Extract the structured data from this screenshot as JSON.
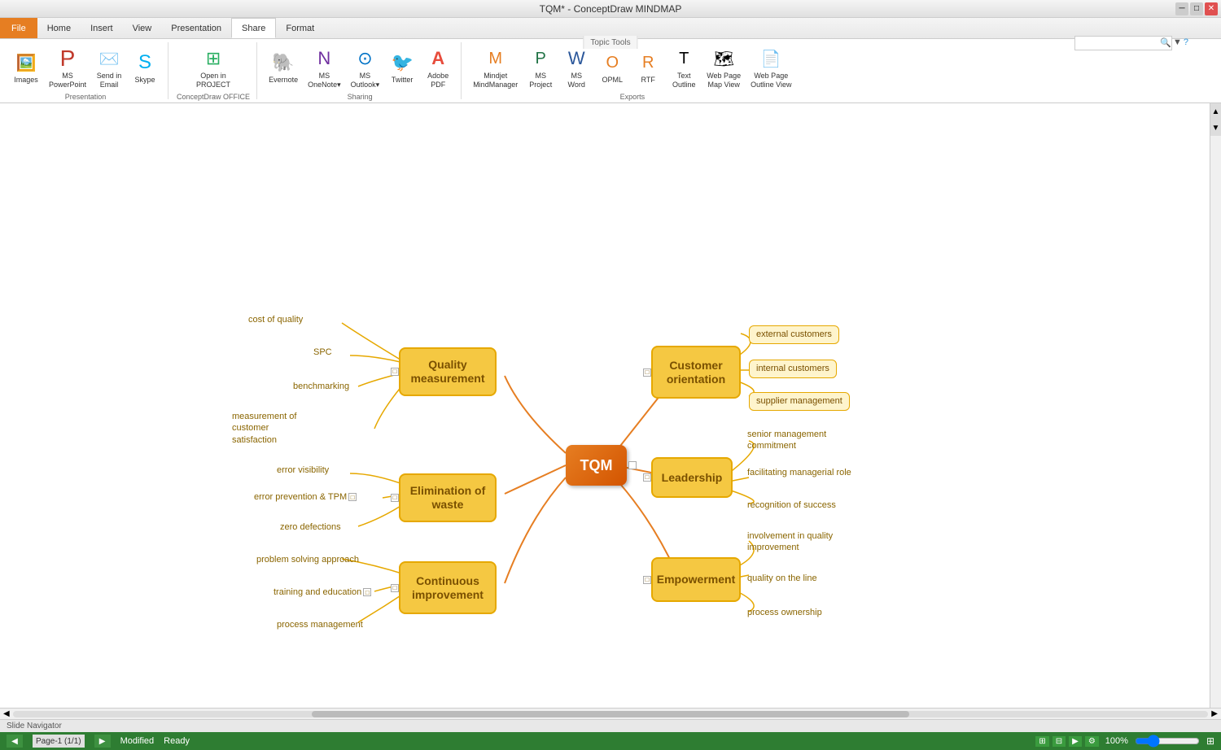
{
  "titleBar": {
    "title": "TQM* - ConceptDraw MINDMAP"
  },
  "ribbon": {
    "topicTools": "Topic Tools",
    "tabs": [
      {
        "label": "File",
        "type": "file",
        "active": false
      },
      {
        "label": "Home",
        "active": false
      },
      {
        "label": "Insert",
        "active": false
      },
      {
        "label": "View",
        "active": false
      },
      {
        "label": "Presentation",
        "active": false
      },
      {
        "label": "Share",
        "active": true
      },
      {
        "label": "Format",
        "active": false
      }
    ],
    "groups": [
      {
        "label": "Presentation",
        "items": [
          {
            "icon": "🖼️",
            "label": "Images",
            "iconClass": ""
          },
          {
            "icon": "📊",
            "label": "MS\nPowerPoint",
            "iconClass": "icon-red"
          },
          {
            "icon": "✉️",
            "label": "Send in\nEmail",
            "iconClass": ""
          },
          {
            "icon": "☁️",
            "label": "Skype",
            "iconClass": "icon-blue"
          }
        ]
      },
      {
        "label": "ConceptDraw OFFICE",
        "items": [
          {
            "icon": "⊞",
            "label": "Open in\nPROJECT",
            "iconClass": "icon-green"
          }
        ]
      },
      {
        "label": "Sharing",
        "items": [
          {
            "icon": "E",
            "label": "Evernote",
            "iconClass": "icon-green",
            "special": "evernote"
          },
          {
            "icon": "N",
            "label": "MS\nOneNote▾",
            "iconClass": "icon-purple",
            "special": "onenote"
          },
          {
            "icon": "⊙",
            "label": "MS\nOutlook▾",
            "iconClass": "icon-blue"
          },
          {
            "icon": "🐦",
            "label": "Twitter",
            "iconClass": "icon-blue",
            "special": "twitter"
          },
          {
            "icon": "A",
            "label": "Adobe\nPDF",
            "iconClass": "icon-red",
            "special": "adobe"
          }
        ]
      },
      {
        "label": "Exports",
        "items": [
          {
            "icon": "M",
            "label": "Mindjet\nMindManager",
            "iconClass": "icon-orange"
          },
          {
            "icon": "📋",
            "label": "MS\nProject",
            "iconClass": "icon-teal"
          },
          {
            "icon": "W",
            "label": "MS\nWord",
            "iconClass": "icon-blue"
          },
          {
            "icon": "O",
            "label": "OPML",
            "iconClass": "icon-orange"
          },
          {
            "icon": "R",
            "label": "RTF",
            "iconClass": "icon-orange"
          },
          {
            "icon": "T",
            "label": "Text\nOutline",
            "iconClass": ""
          },
          {
            "icon": "🗺",
            "label": "Web Page\nMap View",
            "iconClass": ""
          },
          {
            "icon": "📄",
            "label": "Web Page\nOutline View",
            "iconClass": ""
          }
        ]
      }
    ]
  },
  "statusBar": {
    "slideNav": "Slide Navigator",
    "page": "Page-1 (1/1)",
    "modified": "Modified",
    "ready": "Ready",
    "zoom": "100%"
  },
  "mindmap": {
    "center": {
      "label": "TQM"
    },
    "leftBranches": [
      {
        "label": "Quality\nmeasurement",
        "children": [
          "cost of quality",
          "SPC",
          "benchmarking",
          "measurement of customer\nsatisfaction"
        ]
      },
      {
        "label": "Elimination of\nwaste",
        "children": [
          "error visibility",
          "error prevention & TPM",
          "zero defections"
        ]
      },
      {
        "label": "Continuous\nimprovement",
        "children": [
          "problem solving approach",
          "training and education",
          "process management"
        ]
      }
    ],
    "rightBranches": [
      {
        "label": "Customer\norientation",
        "children": [
          "external customers",
          "internal customers",
          "supplier management"
        ]
      },
      {
        "label": "Leadership",
        "children": [
          "senior management\ncommitment",
          "facilitating managerial role",
          "recognition of success"
        ]
      },
      {
        "label": "Empowerment",
        "children": [
          "involvement in quality\nimprovement",
          "quality on the line",
          "process ownership"
        ]
      }
    ]
  }
}
